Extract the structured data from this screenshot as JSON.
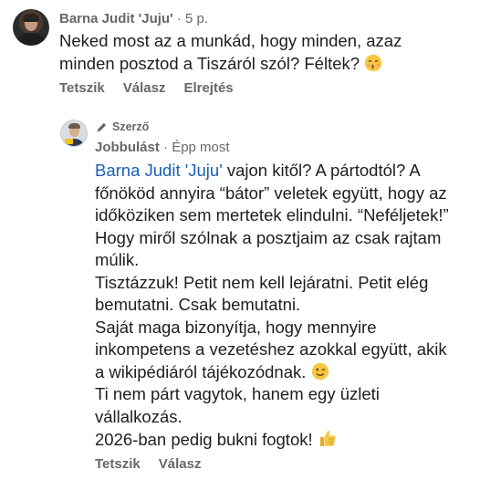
{
  "comment": {
    "author": "Barna Judit 'Juju'",
    "separator": " · ",
    "time": "5 p.",
    "lines": [
      "Neked most az a munkád, hogy minden, azaz",
      "minden posztod a Tiszáról szól? Féltek?"
    ],
    "emoji": "kissing-face-with-closed-eyes",
    "actions": {
      "like": "Tetszik",
      "reply": "Válasz",
      "hide": "Elrejtés"
    }
  },
  "reply": {
    "badge": "Szerző",
    "author": "Jobbulást",
    "separator": " · ",
    "time": "Épp most",
    "mention": "Barna Judit 'Juju'",
    "first_line_rest": " vajon kitől? A pártodtól? A",
    "lines": [
      "főnököd annyira “bátor” veletek együtt, hogy az",
      "időköziken sem mertetek elindulni. “Neféljetek!”",
      "Hogy miről szólnak a posztjaim az csak rajtam",
      "múlik.",
      "Tisztázzuk! Petit nem kell lejáratni. Petit elég",
      "bemutatni. Csak bemutatni.",
      "Saját maga bizonyítja, hogy mennyire",
      "inkompetens a vezetéshez azokkal együtt, akik",
      "a wikipédiáról tájékozódnak.",
      "Ti nem párt vagytok, hanem egy üzleti",
      "vállalkozás.",
      "2026-ban pedig bukni fogtok!"
    ],
    "wink_emoji": "winking-face",
    "thumb_emoji": "thumbs-up",
    "actions": {
      "like": "Tetszik",
      "reply": "Válasz"
    }
  },
  "colors": {
    "text": "#1c1e21",
    "meta": "#65676b",
    "mention": "#1a5fb4",
    "emoji_yellow": "#f7c742"
  }
}
